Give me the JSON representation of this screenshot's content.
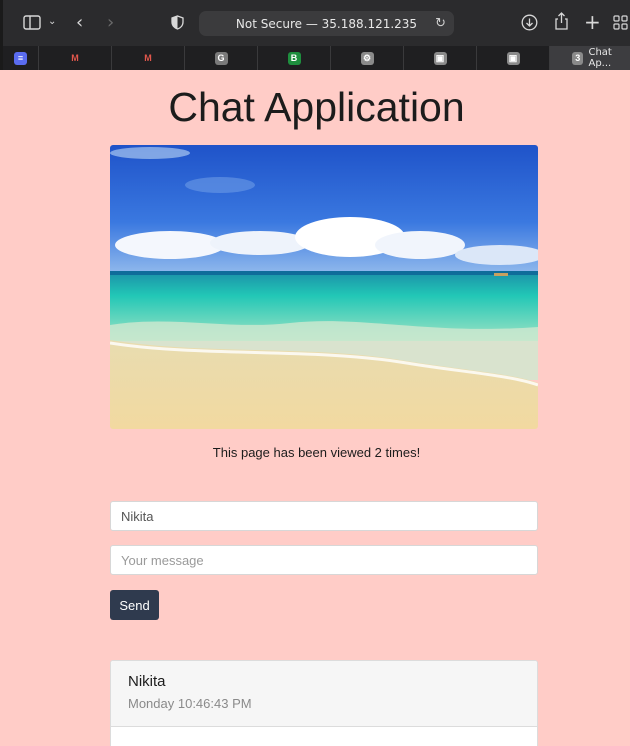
{
  "browser": {
    "address": "Not Secure — 35.188.121.235",
    "active_tab": {
      "count": "3",
      "label": "Chat Ap..."
    },
    "favicons": [
      {
        "icon": "doc-icon",
        "glyph": "≡",
        "color": "#5a6cf0"
      },
      {
        "icon": "gmail-icon",
        "glyph": "M",
        "color": "#e2574c"
      },
      {
        "icon": "gmail-icon",
        "glyph": "M",
        "color": "#e2574c"
      },
      {
        "icon": "g-icon",
        "glyph": "G",
        "color": "#7a7a7a"
      },
      {
        "icon": "b-icon",
        "glyph": "B",
        "color": "#1e8e3e"
      },
      {
        "icon": "gear-icon",
        "glyph": "⚙",
        "color": "#8a8a8a"
      },
      {
        "icon": "chip-icon",
        "glyph": "▣",
        "color": "#8a8a8a"
      },
      {
        "icon": "chip-icon",
        "glyph": "▣",
        "color": "#8a8a8a"
      }
    ]
  },
  "page": {
    "title": "Chat Application",
    "views_text": "This page has been viewed 2 times!",
    "name_value": "Nikita",
    "message_placeholder": "Your message",
    "send_label": "Send"
  },
  "messages": [
    {
      "name": "Nikita",
      "time": "Monday 10:46:43 PM"
    }
  ],
  "colors": {
    "background": "#ffccc7",
    "button": "#2f3a4e"
  }
}
